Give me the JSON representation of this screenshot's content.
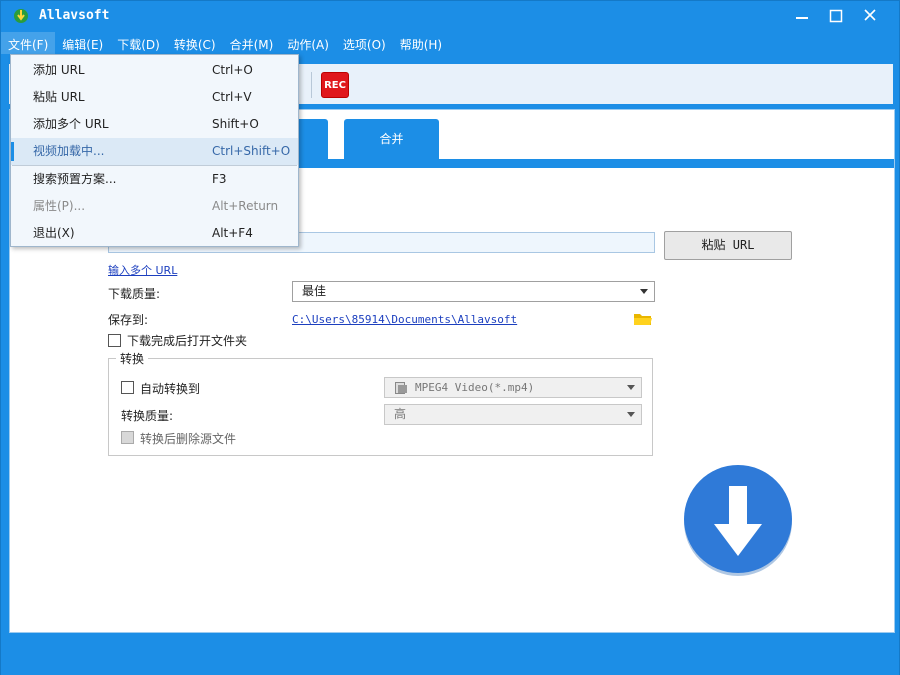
{
  "window": {
    "title": "Allavsoft",
    "brand_color": "#1c8ee6"
  },
  "menubar": {
    "items": [
      {
        "label": "文件(F)"
      },
      {
        "label": "编辑(E)"
      },
      {
        "label": "下载(D)"
      },
      {
        "label": "转换(C)"
      },
      {
        "label": "合并(M)"
      },
      {
        "label": "动作(A)"
      },
      {
        "label": "选项(O)"
      },
      {
        "label": "帮助(H)"
      }
    ]
  },
  "file_menu": {
    "items": [
      {
        "label": "添加 URL",
        "shortcut": "Ctrl+O"
      },
      {
        "label": "粘贴 URL",
        "shortcut": "Ctrl+V"
      },
      {
        "label": "添加多个 URL",
        "shortcut": "Shift+O"
      },
      {
        "label": "视频加载中...",
        "shortcut": "Ctrl+Shift+O"
      },
      {
        "label": "搜索预置方案...",
        "shortcut": "F3"
      },
      {
        "label": "属性(P)...",
        "shortcut": "Alt+Return"
      },
      {
        "label": "退出(X)",
        "shortcut": "Alt+F4"
      }
    ]
  },
  "toolbar": {
    "rec_label": "REC",
    "rec_color": "#e0161b"
  },
  "tabs": {
    "merge_label": "合并"
  },
  "download": {
    "paste_url_label": "粘贴 URL",
    "multi_url_link": "输入多个 URL",
    "quality_label": "下载质量:",
    "quality_value": "最佳",
    "save_to_label": "保存到:",
    "save_path": "C:\\Users\\85914\\Documents\\Allavsoft",
    "open_folder_label": "下载完成后打开文件夹"
  },
  "convert": {
    "group_title": "转换",
    "auto_convert_label": "自动转换到",
    "format_value": "MPEG4 Video(*.mp4)",
    "quality_label": "转换质量:",
    "quality_value": "高",
    "delete_source_label": "转换后删除源文件"
  }
}
